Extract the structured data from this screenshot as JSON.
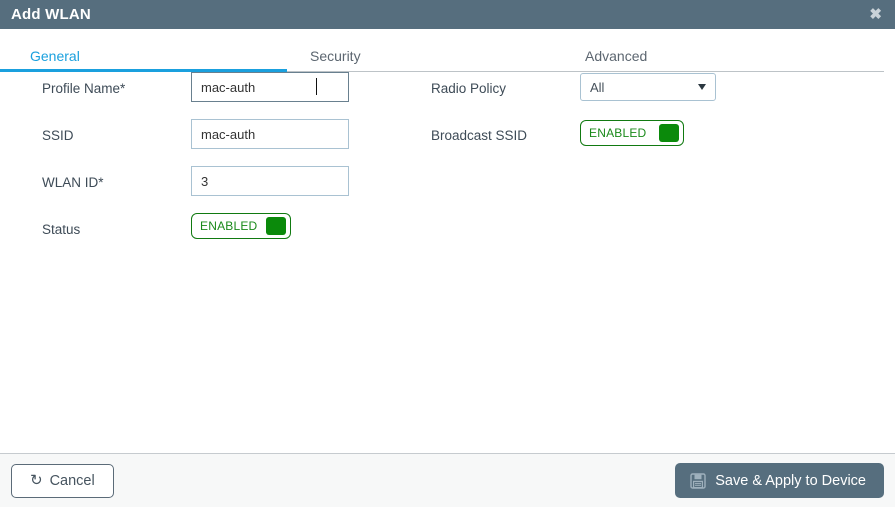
{
  "window": {
    "title": "Add WLAN",
    "close_icon": "close-icon",
    "close_glyph": "✖"
  },
  "tabs": [
    {
      "label": "General",
      "active": true
    },
    {
      "label": "Security",
      "active": false
    },
    {
      "label": "Advanced",
      "active": false
    }
  ],
  "form": {
    "left_column": [
      {
        "label": "Profile Name*",
        "type": "text",
        "value": "mac-auth",
        "placeholder": "",
        "focused": true
      },
      {
        "label": "SSID",
        "type": "text",
        "value": "mac-auth",
        "placeholder": "",
        "focused": false
      },
      {
        "label": "WLAN ID*",
        "type": "text",
        "value": "3",
        "placeholder": "",
        "focused": false
      },
      {
        "label": "Status",
        "type": "toggle",
        "value": "ENABLED"
      }
    ],
    "right_column": [
      {
        "label": "Radio Policy",
        "type": "select",
        "value": "All",
        "caret_icon": "chevron-down-icon"
      },
      {
        "label": "Broadcast SSID",
        "type": "toggle",
        "value": "ENABLED"
      }
    ]
  },
  "footer": {
    "cancel_label": "Cancel",
    "cancel_icon": "undo-arrow-icon",
    "cancel_glyph": "↺",
    "save_label": "Save & Apply to Device",
    "save_icon": "floppy-disk-save-icon"
  },
  "colors": {
    "titlebar": "#566e7e",
    "accent_tab": "#1aa0de",
    "toggle_green": "#0b8a0b",
    "label_text": "#3e4b57",
    "primary_button": "#566e7e",
    "footer_bg": "#f7f8f8"
  }
}
